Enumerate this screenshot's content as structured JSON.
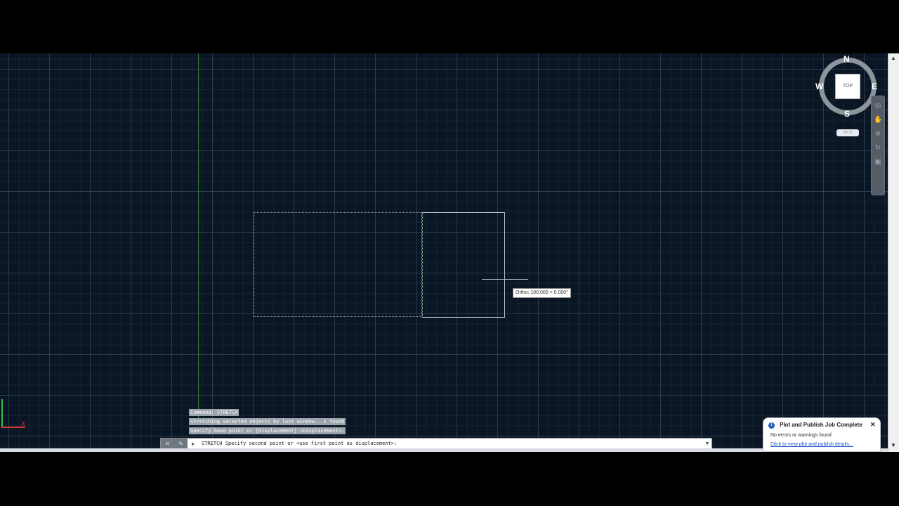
{
  "viewcube": {
    "top_face": "TOP",
    "north": "N",
    "south": "S",
    "east": "E",
    "west": "W",
    "wcs_label": "WCS"
  },
  "drawing": {
    "dynamic_input": "Ortho: 100.000 < 0.000°"
  },
  "ucs_icon": {
    "x_label": "X"
  },
  "command_history": [
    "Command: STRETCH",
    "Stretching selected objects by last window...1 found",
    "Specify base point or [Displacement] <Displacement>:"
  ],
  "command_line": {
    "prompt": "STRETCH Specify second point or <use first point as displacement>:"
  },
  "notification": {
    "title": "Plot and Publish Job Complete",
    "message": "No errors or warnings found",
    "link": "Click to view plot and publish details..."
  },
  "colors": {
    "canvas_bg": "#0b1625",
    "grid_major": "#3c5064",
    "ucs_x": "#d33a3a",
    "ucs_y": "#2fc04a"
  },
  "icons": {
    "close": "close-icon",
    "info": "info-icon",
    "pan": "pan-icon",
    "zoom": "zoom-icon",
    "orbit": "orbit-icon"
  }
}
